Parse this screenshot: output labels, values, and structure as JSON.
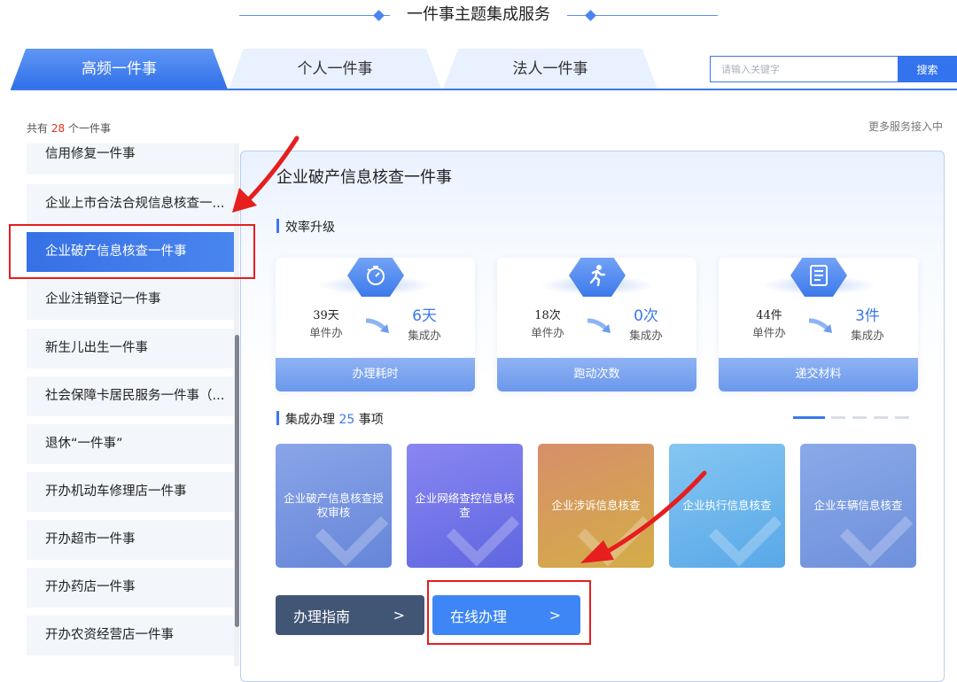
{
  "header": {
    "title": "一件事主题集成服务"
  },
  "tabs": [
    {
      "label": "高频一件事",
      "active": true
    },
    {
      "label": "个人一件事",
      "active": false
    },
    {
      "label": "法人一件事",
      "active": false
    }
  ],
  "search": {
    "placeholder": "请输入关键字",
    "button_label": "搜索"
  },
  "summary": {
    "prefix": "共有",
    "count": "28",
    "suffix": "个一件事",
    "more": "更多服务接入中"
  },
  "sidebar": {
    "items": [
      {
        "label": "信用修复一件事"
      },
      {
        "label": "企业上市合法合规信息核查一..."
      },
      {
        "label": "企业破产信息核查一件事",
        "active": true
      },
      {
        "label": "企业注销登记一件事"
      },
      {
        "label": "新生儿出生一件事"
      },
      {
        "label": "社会保障卡居民服务一件事（..."
      },
      {
        "label": "退休“一件事”"
      },
      {
        "label": "开办机动车修理店一件事"
      },
      {
        "label": "开办超市一件事"
      },
      {
        "label": "开办药店一件事"
      },
      {
        "label": "开办农资经营店一件事"
      }
    ]
  },
  "detail": {
    "title": "企业破产信息核查一件事",
    "efficiency": {
      "heading": "效率升级",
      "cards": [
        {
          "icon": "stopwatch-icon",
          "old_value": "39天",
          "old_label": "单件办",
          "new_value": "6天",
          "new_label": "集成办",
          "footer": "办理耗时"
        },
        {
          "icon": "runner-icon",
          "old_value": "18次",
          "old_label": "单件办",
          "new_value": "0次",
          "new_label": "集成办",
          "footer": "跑动次数"
        },
        {
          "icon": "document-icon",
          "old_value": "44件",
          "old_label": "单件办",
          "new_value": "3件",
          "new_label": "集成办",
          "footer": "递交材料"
        }
      ]
    },
    "integrated": {
      "heading_prefix": "集成办理",
      "count": "25",
      "heading_suffix": "事项",
      "items": [
        {
          "label": "企业破产信息核查授权审核",
          "color_from": "#8aa5e8",
          "color_to": "#6585d8"
        },
        {
          "label": "企业网络查控信息核查",
          "color_from": "#7f7ff0",
          "color_to": "#5f66e0"
        },
        {
          "label": "企业涉诉信息核查",
          "color_from": "#dc9a63",
          "color_to": "#d2a94a"
        },
        {
          "label": "企业执行信息核查",
          "color_from": "#7dc0ef",
          "color_to": "#59a8e8"
        },
        {
          "label": "企业车辆信息核查",
          "color_from": "#86a5e6",
          "color_to": "#6f90dc"
        }
      ],
      "carousel": {
        "pages": 5,
        "active_page": 1
      }
    },
    "buttons": {
      "guide": "办理指南",
      "online": "在线办理",
      "chevron": ">"
    }
  },
  "colors": {
    "accent": "#3a78ee",
    "highlight_box": "#e61e1e",
    "count_red": "#e0311f"
  }
}
